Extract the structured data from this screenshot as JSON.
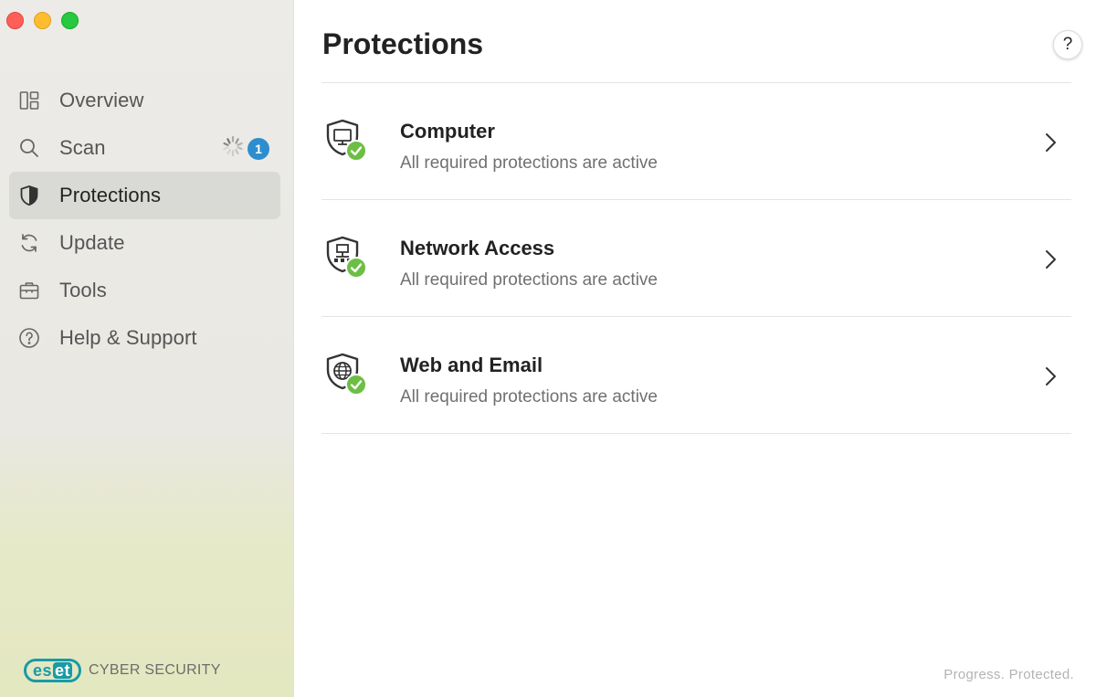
{
  "window": {
    "controls": [
      "close",
      "minimize",
      "zoom"
    ]
  },
  "sidebar": {
    "items": [
      {
        "label": "Overview",
        "icon": "overview-grid-icon",
        "active": false
      },
      {
        "label": "Scan",
        "icon": "search-icon",
        "active": false,
        "status": "scan-in-progress-spinner",
        "badge": "1"
      },
      {
        "label": "Protections",
        "icon": "shield-icon",
        "active": true
      },
      {
        "label": "Update",
        "icon": "refresh-icon",
        "active": false
      },
      {
        "label": "Tools",
        "icon": "briefcase-icon",
        "active": false
      },
      {
        "label": "Help & Support",
        "icon": "question-circle-icon",
        "active": false
      }
    ],
    "brand": {
      "logo_text": "eset",
      "product": "CYBER SECURITY"
    }
  },
  "main": {
    "title": "Protections",
    "help_label": "?",
    "protections": [
      {
        "title": "Computer",
        "status": "All required protections are active",
        "icon": "computer-shield-icon"
      },
      {
        "title": "Network Access",
        "status": "All required protections are active",
        "icon": "network-shield-icon"
      },
      {
        "title": "Web and Email",
        "status": "All required protections are active",
        "icon": "globe-shield-icon"
      }
    ],
    "tagline": "Progress. Protected."
  },
  "colors": {
    "accent_blue": "#2d8ecf",
    "check_green": "#6dbe45",
    "brand_teal": "#1a9aa6",
    "active_bg": "#d9d9d5"
  }
}
